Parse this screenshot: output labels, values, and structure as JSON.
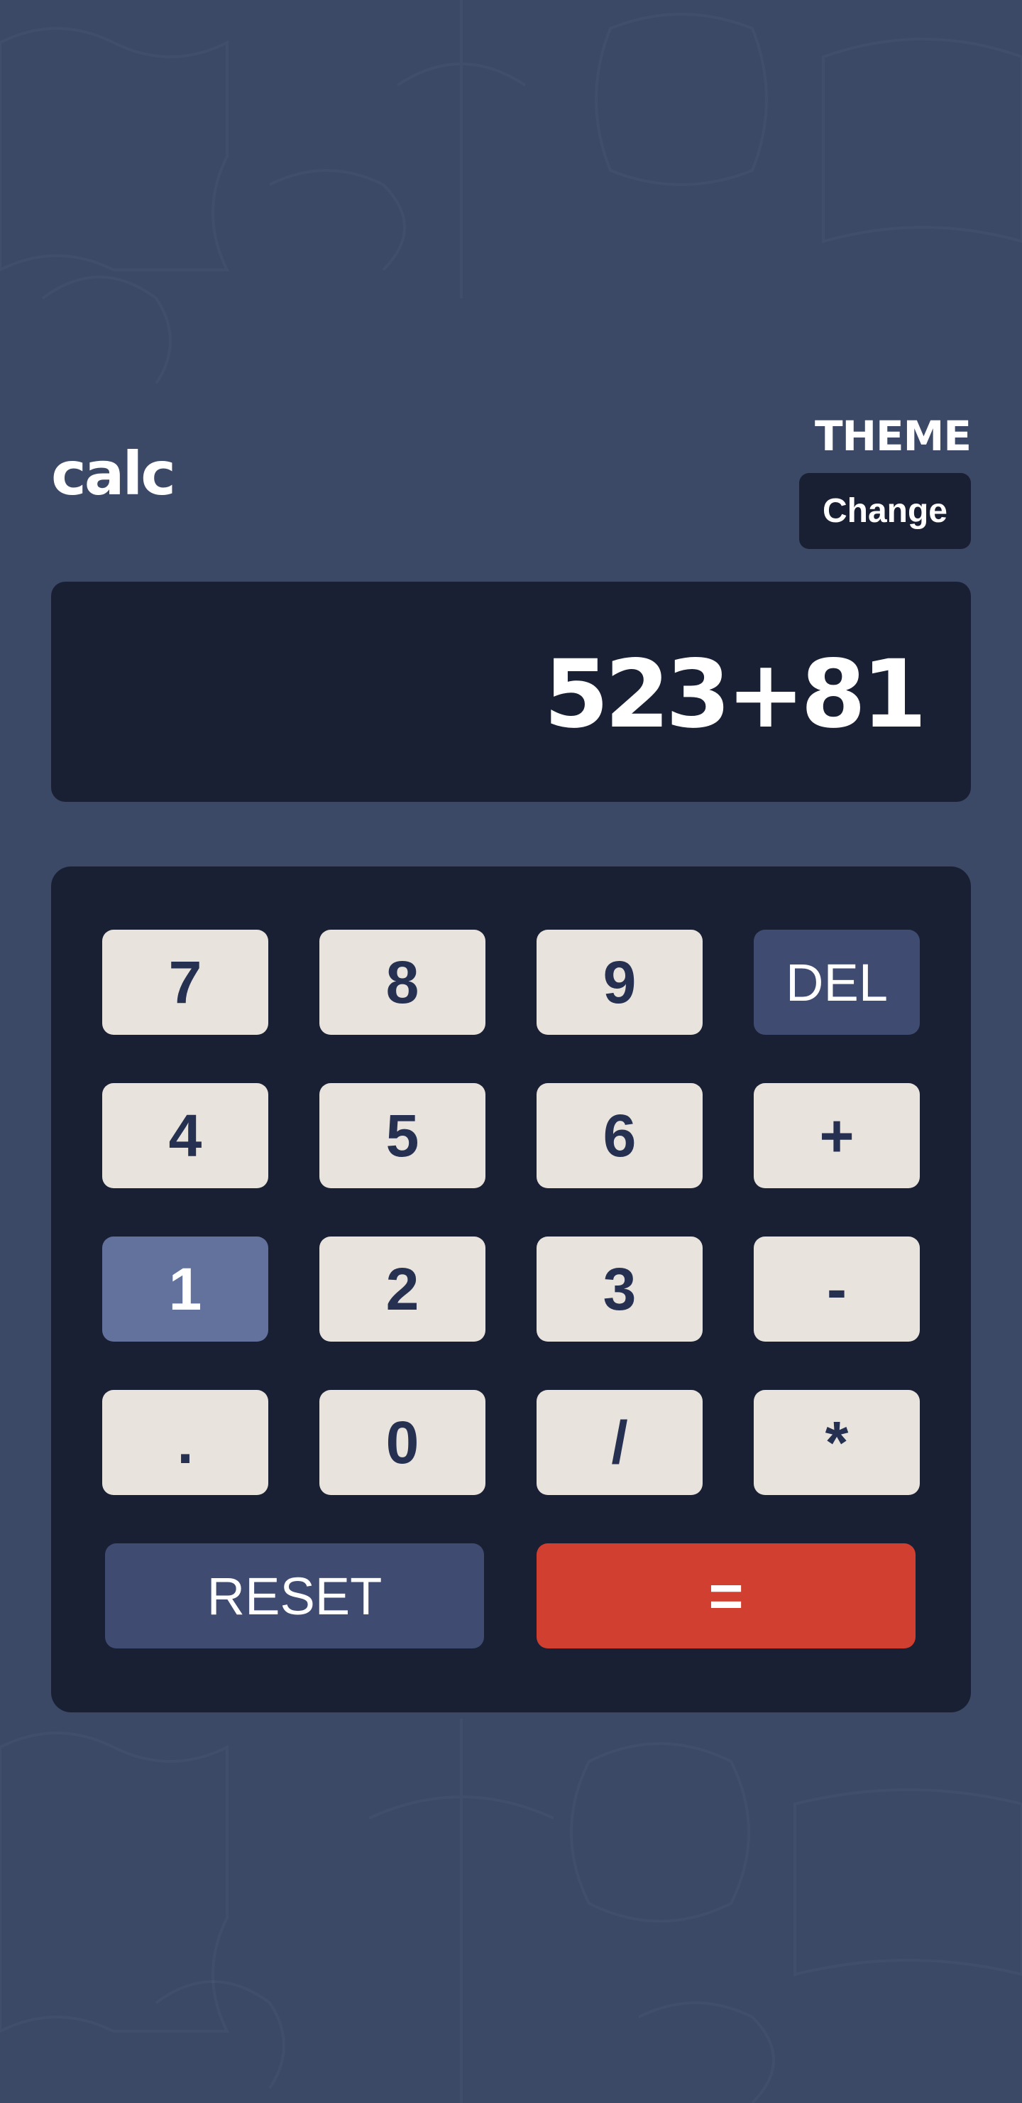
{
  "app": {
    "logo": "calc"
  },
  "theme": {
    "label": "THEME",
    "button_label": "Change"
  },
  "display": {
    "value": "523+81"
  },
  "keys": {
    "seven": "7",
    "eight": "8",
    "nine": "9",
    "del": "DEL",
    "four": "4",
    "five": "5",
    "six": "6",
    "plus": "+",
    "one": "1",
    "two": "2",
    "three": "3",
    "minus": "-",
    "decimal": ".",
    "zero": "0",
    "divide": "/",
    "multiply": "*",
    "reset": "RESET",
    "equals": "="
  },
  "colors": {
    "background": "#3b4866",
    "panel": "#1a2033",
    "key": "#e8e3dd",
    "key_text": "#263050",
    "function_key": "#3f4b71",
    "active_key": "#63719d",
    "equals_key": "#d03f30"
  }
}
